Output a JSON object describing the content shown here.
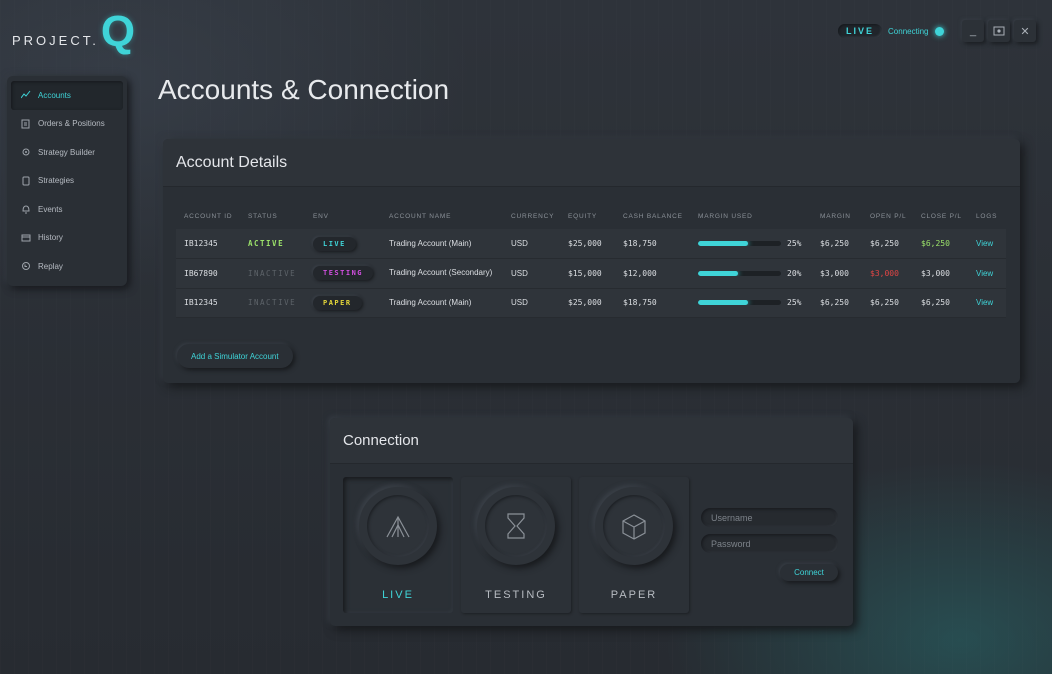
{
  "app": {
    "logo_text": "PROJECT.",
    "logo_letter": "Q",
    "live_badge": "LIVE",
    "connection_status": "Connecting",
    "window_buttons": [
      "_",
      "⌗",
      "✕"
    ]
  },
  "colors": {
    "accent": "#3fd4d8",
    "active": "#9ce36a",
    "testing": "#d24fe0",
    "paper": "#e5d83a",
    "loss": "#e04545"
  },
  "sidebar": {
    "items": [
      {
        "label": "Accounts",
        "icon": "accounts-icon",
        "active": true
      },
      {
        "label": "Orders & Positions",
        "icon": "orders-icon",
        "active": false
      },
      {
        "label": "Strategy Builder",
        "icon": "strategy-builder-icon",
        "active": false
      },
      {
        "label": "Strategies",
        "icon": "strategies-icon",
        "active": false
      },
      {
        "label": "Events",
        "icon": "bell-icon",
        "active": false
      },
      {
        "label": "History",
        "icon": "history-icon",
        "active": false
      },
      {
        "label": "Replay",
        "icon": "replay-icon",
        "active": false
      }
    ]
  },
  "page": {
    "title": "Accounts & Connection"
  },
  "account_details": {
    "title": "Account Details",
    "columns": [
      "ACCOUNT ID",
      "STATUS",
      "ENV",
      "ACCOUNT NAME",
      "CURRENCY",
      "EQUITY",
      "CASH BALANCE",
      "MARGIN USED",
      "MARGIN",
      "OPEN P/L",
      "CLOSE P/L",
      "LOGS"
    ],
    "rows": [
      {
        "id": "IB12345",
        "status": "ACTIVE",
        "env": "LIVE",
        "name": "Trading Account (Main)",
        "currency": "USD",
        "equity": "$25,000",
        "cash": "$18,750",
        "margin_used_pct": 25,
        "margin_used_label": "25%",
        "margin": "$6,250",
        "open_pl": "$6,250",
        "close_pl": "$6,250",
        "logs": "View"
      },
      {
        "id": "IB67890",
        "status": "INACTIVE",
        "env": "TESTING",
        "name": "Trading Account (Secondary)",
        "currency": "USD",
        "equity": "$15,000",
        "cash": "$12,000",
        "margin_used_pct": 20,
        "margin_used_label": "20%",
        "margin": "$3,000",
        "open_pl": "$3,000",
        "close_pl": "$3,000",
        "logs": "View"
      },
      {
        "id": "IB12345",
        "status": "INACTIVE",
        "env": "PAPER",
        "name": "Trading Account (Main)",
        "currency": "USD",
        "equity": "$25,000",
        "cash": "$18,750",
        "margin_used_pct": 25,
        "margin_used_label": "25%",
        "margin": "$6,250",
        "open_pl": "$6,250",
        "close_pl": "$6,250",
        "logs": "View"
      }
    ],
    "add_button": "Add a Simulator Account"
  },
  "connection": {
    "title": "Connection",
    "envs": [
      {
        "label": "LIVE",
        "icon": "live-icon",
        "selected": true
      },
      {
        "label": "TESTING",
        "icon": "hourglass-icon",
        "selected": false
      },
      {
        "label": "PAPER",
        "icon": "cube-icon",
        "selected": false
      }
    ],
    "username_placeholder": "Username",
    "password_placeholder": "Password",
    "connect_button": "Connect"
  }
}
